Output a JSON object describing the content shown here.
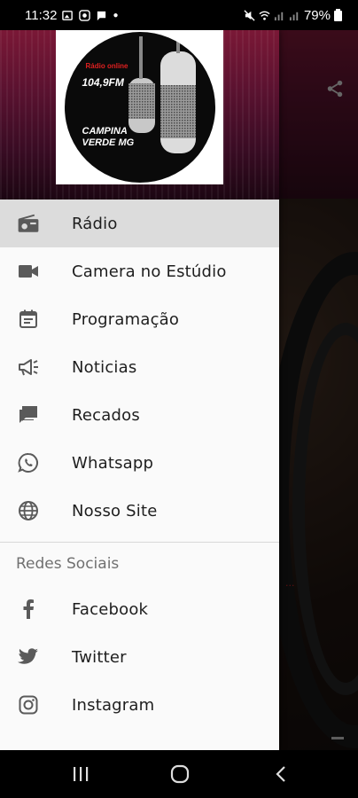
{
  "status_bar": {
    "time": "11:32",
    "battery": "79%"
  },
  "header": {
    "logo": {
      "line_small": "Rádio online",
      "frequency": "104,9FM",
      "city_line1": "CAMPINA",
      "city_line2": "VERDE MG"
    }
  },
  "menu": {
    "items": [
      {
        "label": "Rádio",
        "icon": "radio-icon",
        "active": true
      },
      {
        "label": "Camera no Estúdio",
        "icon": "videocam-icon"
      },
      {
        "label": "Programação",
        "icon": "calendar-icon"
      },
      {
        "label": "Noticias",
        "icon": "megaphone-icon"
      },
      {
        "label": "Recados",
        "icon": "chat-icon"
      },
      {
        "label": "Whatsapp",
        "icon": "whatsapp-icon"
      },
      {
        "label": "Nosso Site",
        "icon": "globe-icon"
      }
    ],
    "section_title": "Redes Sociais",
    "social": [
      {
        "label": "Facebook",
        "icon": "facebook-icon"
      },
      {
        "label": "Twitter",
        "icon": "twitter-icon"
      },
      {
        "label": "Instagram",
        "icon": "instagram-icon"
      }
    ]
  },
  "colors": {
    "drawer_bg": "#fafafa",
    "active_item_bg": "#dcdcdc",
    "icon_color": "#5a5a5a"
  }
}
